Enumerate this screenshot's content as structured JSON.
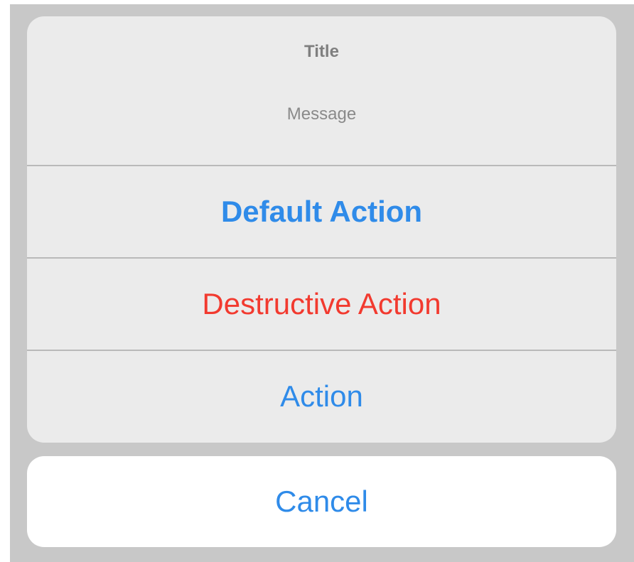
{
  "alert": {
    "title": "Title",
    "message": "Message",
    "actions": [
      {
        "label": "Default Action",
        "style": "default",
        "color": "#2F8BE9"
      },
      {
        "label": "Destructive Action",
        "style": "destructive",
        "color": "#F23A2F"
      },
      {
        "label": "Action",
        "style": "normal",
        "color": "#2F8BE9"
      }
    ],
    "cancel": {
      "label": "Cancel",
      "color": "#2F8BE9"
    }
  }
}
